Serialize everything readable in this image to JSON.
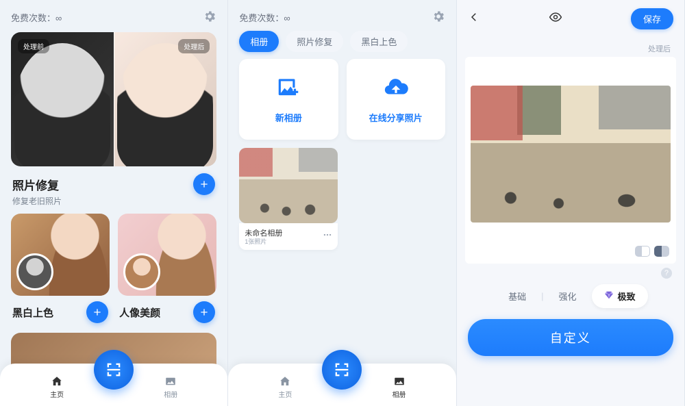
{
  "s1": {
    "free_label": "免费次数：∞",
    "hero_before": "处理前",
    "hero_after": "处理后",
    "photo_repair_title": "照片修复",
    "photo_repair_sub": "修复老旧照片",
    "bw_color_title": "黑白上色",
    "beauty_title": "人像美颜",
    "nav_home": "主页",
    "nav_album": "相册"
  },
  "s2": {
    "free_label": "免费次数：∞",
    "tabs": {
      "album": "相册",
      "repair": "照片修复",
      "bw": "黑白上色"
    },
    "new_album": "新相册",
    "share_online": "在线分享照片",
    "album_name": "未命名相册",
    "album_count": "1张照片",
    "nav_home": "主页",
    "nav_album": "相册"
  },
  "s3": {
    "save": "保存",
    "processed_tag": "处理后",
    "level_basic": "基础",
    "level_enhance": "强化",
    "level_ultra": "极致",
    "custom": "自定义",
    "help": "?"
  }
}
